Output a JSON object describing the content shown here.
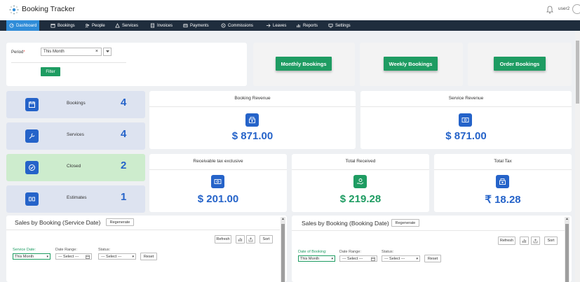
{
  "app": {
    "title": "Booking Tracker",
    "username": "user2"
  },
  "nav": [
    {
      "label": "Dashboard",
      "icon": "dashboard-icon",
      "active": true
    },
    {
      "label": "Bookings",
      "icon": "bookings-icon"
    },
    {
      "label": "People",
      "icon": "people-icon"
    },
    {
      "label": "Services",
      "icon": "services-icon"
    },
    {
      "label": "Invoices",
      "icon": "invoices-icon"
    },
    {
      "label": "Payments",
      "icon": "payments-icon"
    },
    {
      "label": "Commissions",
      "icon": "commissions-icon"
    },
    {
      "label": "Leaves",
      "icon": "leaves-icon"
    },
    {
      "label": "Reports",
      "icon": "reports-icon"
    },
    {
      "label": "Settings",
      "icon": "settings-icon"
    }
  ],
  "filter": {
    "period_label": "Period",
    "required_mark": "*",
    "period_value": "This Month",
    "clear": "×",
    "filter_button": "Filter"
  },
  "quick_buttons": {
    "monthly": "Monthly Bookings",
    "weekly": "Weekly Bookings",
    "order": "Order Bookings"
  },
  "stats": [
    {
      "label": "Bookings",
      "value": "4",
      "bg": "#dde3f0"
    },
    {
      "label": "Services",
      "value": "4",
      "bg": "#dde3f0"
    },
    {
      "label": "Closed",
      "value": "2",
      "bg": "#cdeccd"
    },
    {
      "label": "Estimates",
      "value": "1",
      "bg": "#dde3f0"
    }
  ],
  "revenue": {
    "booking": {
      "title": "Booking Revenue",
      "value": "$ 871.00"
    },
    "service": {
      "title": "Service Revenue",
      "value": "$ 871.00"
    },
    "receivable": {
      "title": "Receivable tax exclusive",
      "value": "$ 201.00"
    },
    "received": {
      "title": "Total Received",
      "value": "$ 219.28"
    },
    "tax": {
      "title": "Total Tax",
      "value": "₹ 18.28"
    }
  },
  "colors": {
    "blue": "#2563c9",
    "green": "#1e9c62",
    "nav_bg": "#1f2d3d",
    "nav_active": "#2f8cd8"
  },
  "sales_left": {
    "title": "Sales by Booking (Service Date)",
    "regenerate": "Regenerate",
    "refresh": "Refresh",
    "sort": "Sort",
    "date_label": "Service Date:",
    "date_value": "This Month",
    "range_label": "Date Range:",
    "range_value": "--- Select ---",
    "status_label": "Status:",
    "status_value": "--- Select ---",
    "reset": "Reset"
  },
  "sales_right": {
    "title": "Sales by Booking (Booking Date)",
    "regenerate": "Regenerate",
    "refresh": "Refresh",
    "sort": "Sort",
    "date_label": "Date of Booking:",
    "date_value": "This Month",
    "range_label": "Date Range:",
    "range_value": "--- Select ---",
    "status_label": "Status:",
    "status_value": "--- Select ---",
    "reset": "Reset"
  }
}
